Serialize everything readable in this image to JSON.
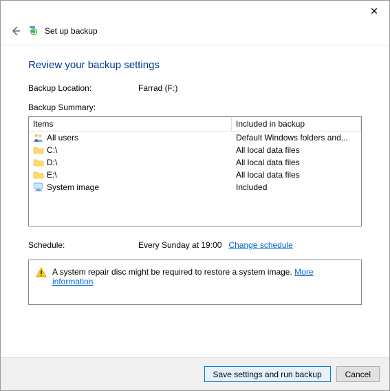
{
  "titlebar": {
    "close": "✕"
  },
  "header": {
    "wizard_title": "Set up backup"
  },
  "page": {
    "title": "Review your backup settings",
    "location_label": "Backup Location:",
    "location_value": "Farrad (F:)",
    "summary_label": "Backup Summary:",
    "columns": {
      "items": "Items",
      "included": "Included in backup"
    },
    "rows": [
      {
        "icon": "users",
        "item": "All users",
        "included": "Default Windows folders and..."
      },
      {
        "icon": "folder",
        "item": "C:\\",
        "included": "All local data files"
      },
      {
        "icon": "folder",
        "item": "D:\\",
        "included": "All local data files"
      },
      {
        "icon": "folder",
        "item": "E:\\",
        "included": "All local data files"
      },
      {
        "icon": "monitor",
        "item": "System image",
        "included": "Included"
      }
    ],
    "schedule_label": "Schedule:",
    "schedule_value": "Every Sunday at 19:00",
    "change_schedule": "Change schedule",
    "warning_text": "A system repair disc might be required to restore a system image. ",
    "more_info": "More information"
  },
  "footer": {
    "save": "Save settings and run backup",
    "cancel": "Cancel"
  }
}
